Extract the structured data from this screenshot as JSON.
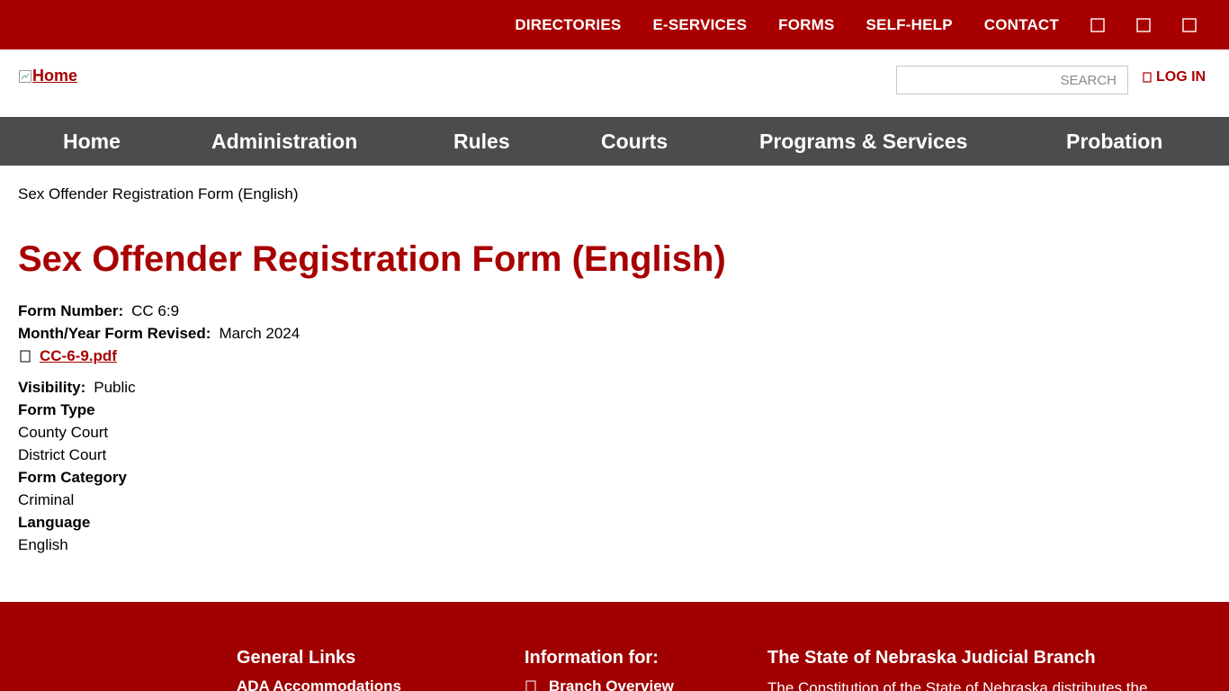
{
  "topnav": {
    "items": [
      "DIRECTORIES",
      "E-SERVICES",
      "FORMS",
      "SELF-HELP",
      "CONTACT"
    ],
    "icons": [
      "facebook-icon",
      "twitter-icon",
      "youtube-icon"
    ]
  },
  "header": {
    "logo_alt": "Home",
    "search_placeholder": "SEARCH",
    "login_label": "LOG IN"
  },
  "mainnav": {
    "items": [
      "Home",
      "Administration",
      "Rules",
      "Courts",
      "Programs & Services",
      "Probation"
    ]
  },
  "breadcrumb": "Sex Offender Registration Form (English)",
  "page": {
    "title": "Sex Offender Registration Form (English)",
    "form_number_label": "Form Number:",
    "form_number": "CC 6:9",
    "revised_label": "Month/Year Form Revised:",
    "revised": "March 2024",
    "file_link": "CC-6-9.pdf",
    "visibility_label": "Visibility:",
    "visibility": "Public",
    "form_type_label": "Form Type",
    "form_types": [
      "County Court",
      "District Court"
    ],
    "form_category_label": "Form Category",
    "form_category": "Criminal",
    "language_label": "Language",
    "language": "English"
  },
  "footer": {
    "col1_title": "General Links",
    "col1_link": "ADA Accommodations",
    "col2_title": "Information for:",
    "col2_link": "Branch Overview",
    "col3_title": "The State of Nebraska Judicial Branch",
    "col3_text": "The Constitution of the State of Nebraska distributes the"
  },
  "colors": {
    "brand_red": "#a80000",
    "nav_gray": "#4c4c4c",
    "footer_red": "#a00000"
  }
}
